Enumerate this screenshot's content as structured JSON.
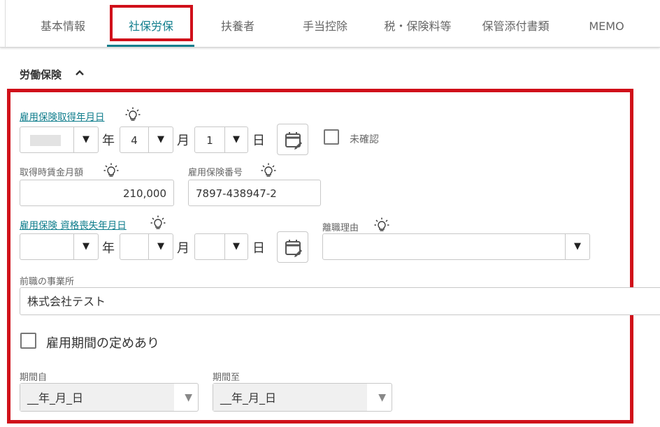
{
  "tabs": [
    {
      "label": "基本情報",
      "active": false
    },
    {
      "label": "社保労保",
      "active": true
    },
    {
      "label": "扶養者",
      "active": false
    },
    {
      "label": "手当控除",
      "active": false
    },
    {
      "label": "税・保険料等",
      "active": false
    },
    {
      "label": "保管添付書類",
      "active": false
    },
    {
      "label": "MEMO",
      "active": false
    }
  ],
  "colors": {
    "accent": "#0f7d8c",
    "highlight": "#d0101a"
  },
  "section": {
    "title": "労働保険",
    "toggle_icon": "chevron-up-icon"
  },
  "acquisition_date": {
    "label": "雇用保険取得年月日",
    "year_value": "",
    "year_unit": "年",
    "month_value": "4",
    "month_unit": "月",
    "day_value": "1",
    "day_unit": "日",
    "unconfirmed_label": "未確認"
  },
  "wage": {
    "label": "取得時賃金月額",
    "value": "210,000"
  },
  "insurance_number": {
    "label": "雇用保険番号",
    "value": "7897-438947-2"
  },
  "loss_date": {
    "label": "雇用保険 資格喪失年月日",
    "year_unit": "年",
    "month_unit": "月",
    "day_unit": "日"
  },
  "leave_reason": {
    "label": "離職理由",
    "value": ""
  },
  "previous_office": {
    "label": "前職の事業所",
    "value": "株式会社テスト"
  },
  "employment_period": {
    "checkbox_label": "雇用期間の定めあり"
  },
  "period_from": {
    "label": "期間自",
    "value": "__年_月_日"
  },
  "period_to": {
    "label": "期間至",
    "value": "__年_月_日"
  },
  "arrow_glyph": "▼"
}
